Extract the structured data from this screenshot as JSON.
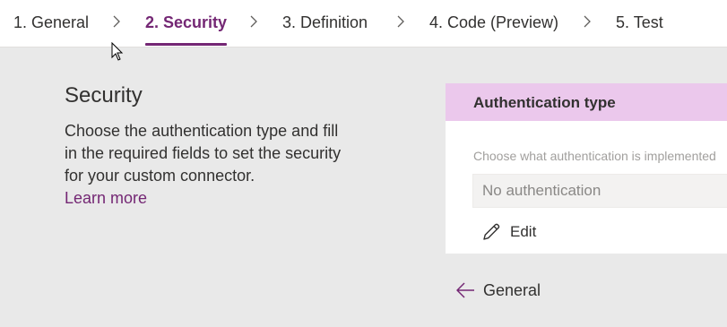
{
  "steps": [
    {
      "label": "1. General"
    },
    {
      "label": "2. Security"
    },
    {
      "label": "3. Definition"
    },
    {
      "label": "4. Code (Preview)"
    },
    {
      "label": "5. Test"
    }
  ],
  "active_step": "2. Security",
  "intro": {
    "title": "Security",
    "description": "Choose the authentication type and fill in the required fields to set the security for your custom connector.",
    "learn_more": "Learn more"
  },
  "auth_card": {
    "header": "Authentication type",
    "help_text": "Choose what authentication is implemented",
    "selected_value": "No authentication",
    "edit_label": "Edit"
  },
  "navigation": {
    "back_label": "General"
  },
  "colors": {
    "accent": "#742774",
    "card_header_bg": "#ebc8ec",
    "page_bg": "#e9e9e9"
  },
  "icons": [
    "chevron-right-icon",
    "pencil-icon",
    "arrow-left-icon",
    "mouse-cursor-icon"
  ]
}
